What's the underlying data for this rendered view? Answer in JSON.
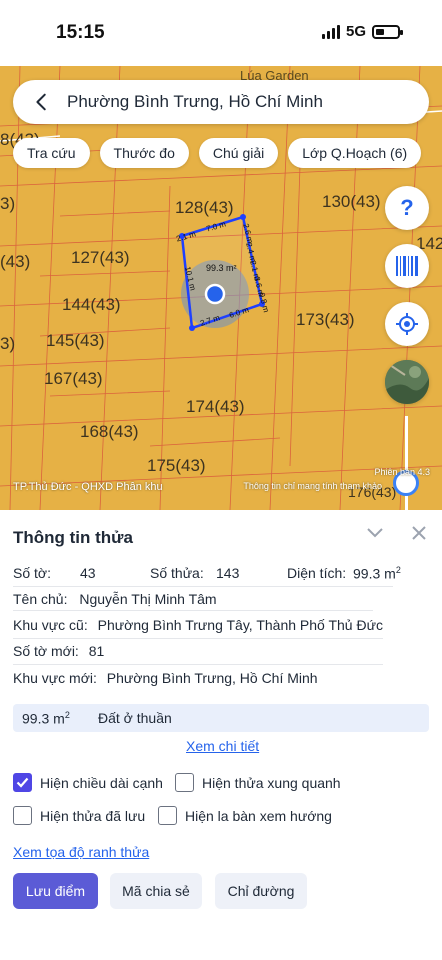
{
  "status_bar": {
    "time": "15:15",
    "network": "5G"
  },
  "search": {
    "query": "Phường Bình Trưng, Hồ Chí Minh"
  },
  "chips": [
    "Tra cứu",
    "Thước đo",
    "Chú giải",
    "Lớp Q.Hoạch (6)"
  ],
  "map": {
    "parcels": [
      "128(43)",
      "130(43)",
      "127(43)",
      "144(43)",
      "173(43)",
      "145(43)",
      "167(43)",
      "174(43)",
      "168(43)",
      "175(43)",
      "(43)",
      "3)",
      "8(43)",
      "142",
      "3)",
      "176(43)",
      "Lúa Garden"
    ],
    "edges": [
      "7.0 m",
      "2.1 m",
      "10.1 m",
      "2.7 m",
      "6.0 m",
      "2.6 m",
      "2.4 m",
      "2.1 m",
      "3.6 m",
      "0.8 m"
    ],
    "area": "99.3 m²",
    "footer": "TP.Thủ Đức - QHXD Phân khu",
    "note": "Thông tin chỉ mang tính tham khảo",
    "version": "Phiên bản 4.3"
  },
  "fabs": {
    "help_label": "?"
  },
  "sheet": {
    "title": "Thông tin thửa",
    "so_to_label": "Số tờ:",
    "so_to": "43",
    "so_thua_label": "Số thửa:",
    "so_thua": "143",
    "dien_tich_label": "Diện tích:",
    "dien_tich": "99.3 m",
    "dien_tich_sup": "2",
    "chu_label": "Tên chủ:",
    "chu": "Nguyễn Thị Minh Tâm",
    "kv_cu_label": "Khu vực cũ:",
    "kv_cu": "Phường Bình Trưng Tây, Thành Phố Thủ Đức",
    "so_to_moi_label": "Số tờ mới:",
    "so_to_moi": "81",
    "kv_moi_label": "Khu vực mới:",
    "kv_moi": "Phường Bình Trưng, Hồ Chí Minh",
    "use_area": "99.3 m",
    "use_area_sup": "2",
    "use_type": "Đất ở thuần",
    "details_link": "Xem chi tiết",
    "options": [
      {
        "label": "Hiện chiều dài cạnh",
        "checked": true
      },
      {
        "label": "Hiện thửa xung quanh",
        "checked": false
      },
      {
        "label": "Hiện thửa đã lưu",
        "checked": false
      },
      {
        "label": "Hiện la bàn xem hướng",
        "checked": false
      }
    ],
    "coords_link": "Xem tọa độ ranh thửa",
    "buttons": {
      "save": "Lưu điểm",
      "share": "Mã chia sẻ",
      "directions": "Chỉ đường"
    }
  },
  "colors": {
    "map_bg": "#e6b145",
    "accent": "#5b5bd6",
    "link": "#2563eb"
  }
}
